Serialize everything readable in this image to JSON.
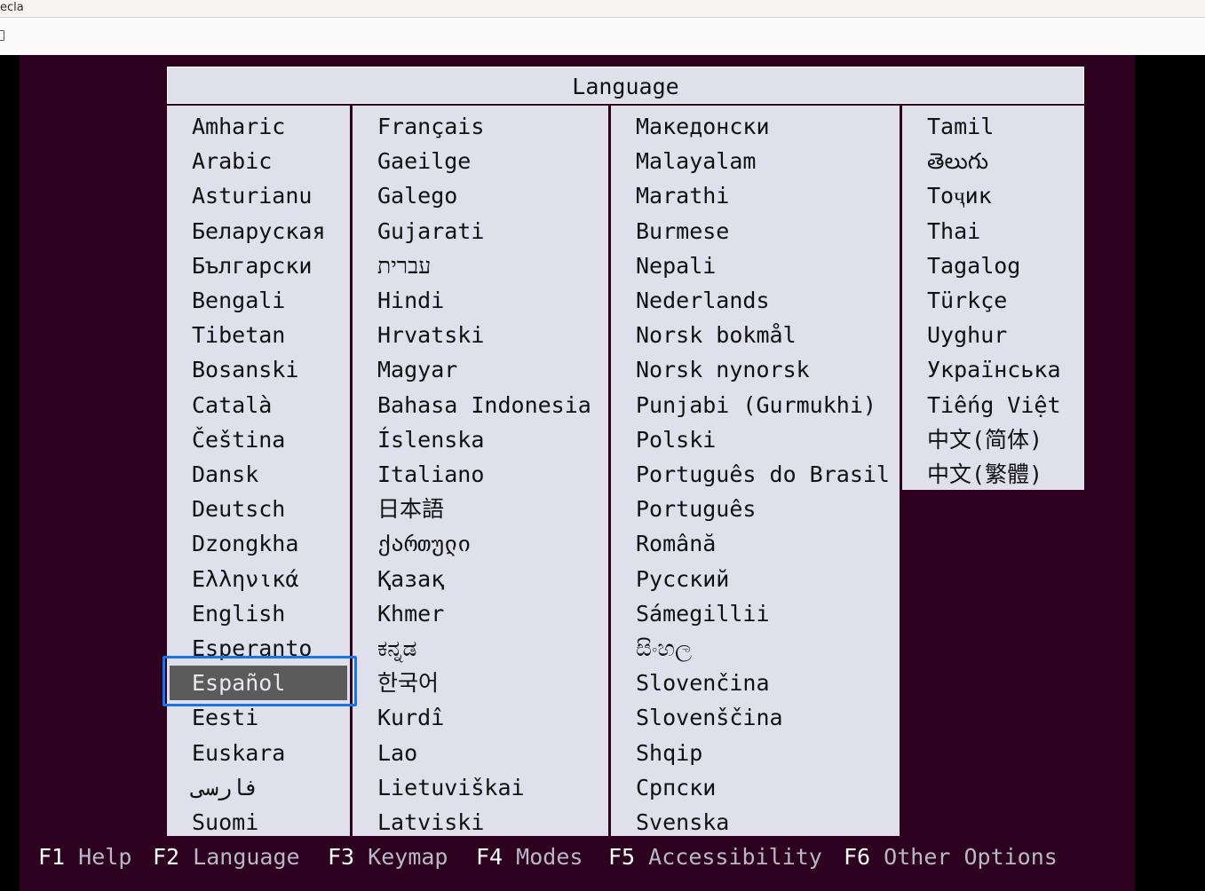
{
  "window": {
    "title": "ecla"
  },
  "toolbar": {
    "icon": "document-icon"
  },
  "dialog": {
    "title": "Language",
    "selected": "Español",
    "columns": [
      [
        "Amharic",
        "Arabic",
        "Asturianu",
        "Беларуская",
        "Български",
        "Bengali",
        "Tibetan",
        "Bosanski",
        "Català",
        "Čeština",
        "Dansk",
        "Deutsch",
        "Dzongkha",
        "Ελληνικά",
        "English",
        "Esperanto",
        "Español",
        "Eesti",
        "Euskara",
        "فارسی",
        "Suomi"
      ],
      [
        "Français",
        "Gaeilge",
        "Galego",
        "Gujarati",
        "עברית",
        "Hindi",
        "Hrvatski",
        "Magyar",
        "Bahasa Indonesia",
        "Íslenska",
        "Italiano",
        "日本語",
        "ქართული",
        "Қазақ",
        "Khmer",
        "ಕನ್ನಡ",
        "한국어",
        "Kurdî",
        "Lao",
        "Lietuviškai",
        "Latviski"
      ],
      [
        "Македонски",
        "Malayalam",
        "Marathi",
        "Burmese",
        "Nepali",
        "Nederlands",
        "Norsk bokmål",
        "Norsk nynorsk",
        "Punjabi (Gurmukhi)",
        "Polski",
        "Português do Brasil",
        "Português",
        "Română",
        "Русский",
        "Sámegillii",
        "සිංහල",
        "Slovenčina",
        "Slovenščina",
        "Shqip",
        "Српски",
        "Svenska"
      ],
      [
        "Tamil",
        "తెలుగు",
        "Тоҷик",
        "Thai",
        "Tagalog",
        "Türkçe",
        "Uyghur",
        "Українська",
        "Tiếng Việt",
        "中文(简体)",
        "中文(繁體)"
      ]
    ]
  },
  "function_keys": [
    {
      "key": "F1",
      "label": "Help"
    },
    {
      "key": "F2",
      "label": "Language"
    },
    {
      "key": "F3",
      "label": "Keymap"
    },
    {
      "key": "F4",
      "label": "Modes"
    },
    {
      "key": "F5",
      "label": "Accessibility"
    },
    {
      "key": "F6",
      "label": "Other Options"
    }
  ],
  "colors": {
    "screen_background": "#2c001e",
    "menu_background": "#e0e0ec",
    "selection_background": "#5b5b5b",
    "focus_outline": "#1a73e8"
  }
}
